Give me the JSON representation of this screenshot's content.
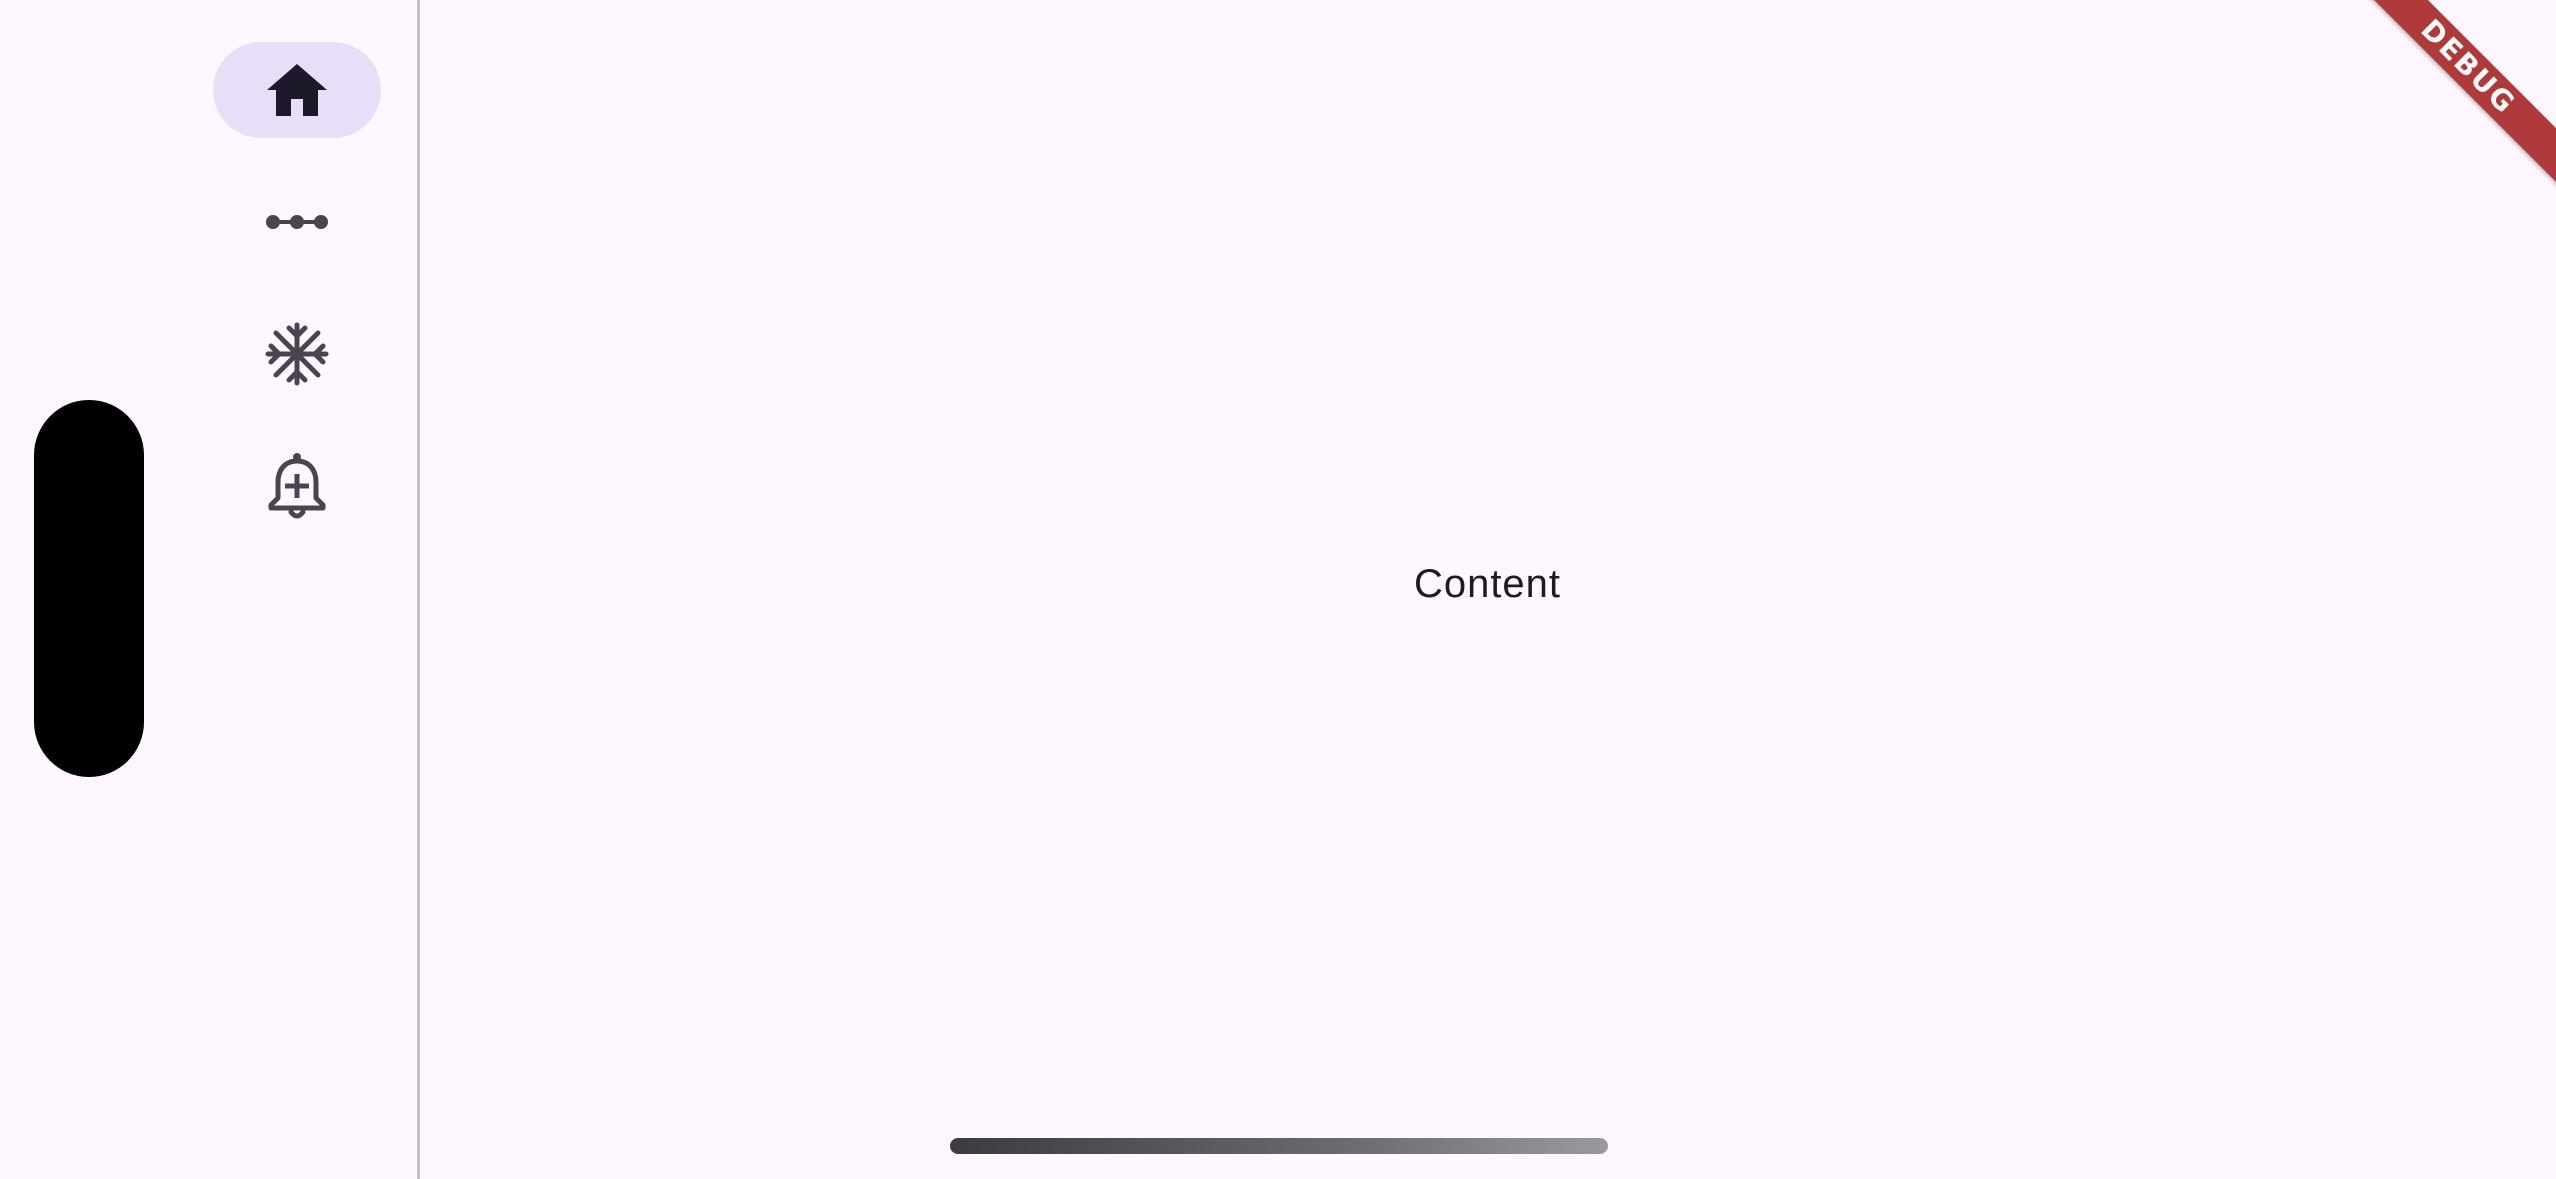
{
  "nav_rail": {
    "items": [
      {
        "icon": "home-icon",
        "selected": true
      },
      {
        "icon": "commit-icon",
        "selected": false
      },
      {
        "icon": "snowflake-icon",
        "selected": false
      },
      {
        "icon": "add-alert-icon",
        "selected": false
      }
    ]
  },
  "main": {
    "content_label": "Content"
  },
  "debug_banner": {
    "label": "DEBUG"
  },
  "colors": {
    "background": "#FEF7FF",
    "selected_indicator": "#E8DEF8",
    "icon": "#49454F",
    "selected_icon": "#1D192B",
    "debug_banner": "#B03A3A"
  }
}
